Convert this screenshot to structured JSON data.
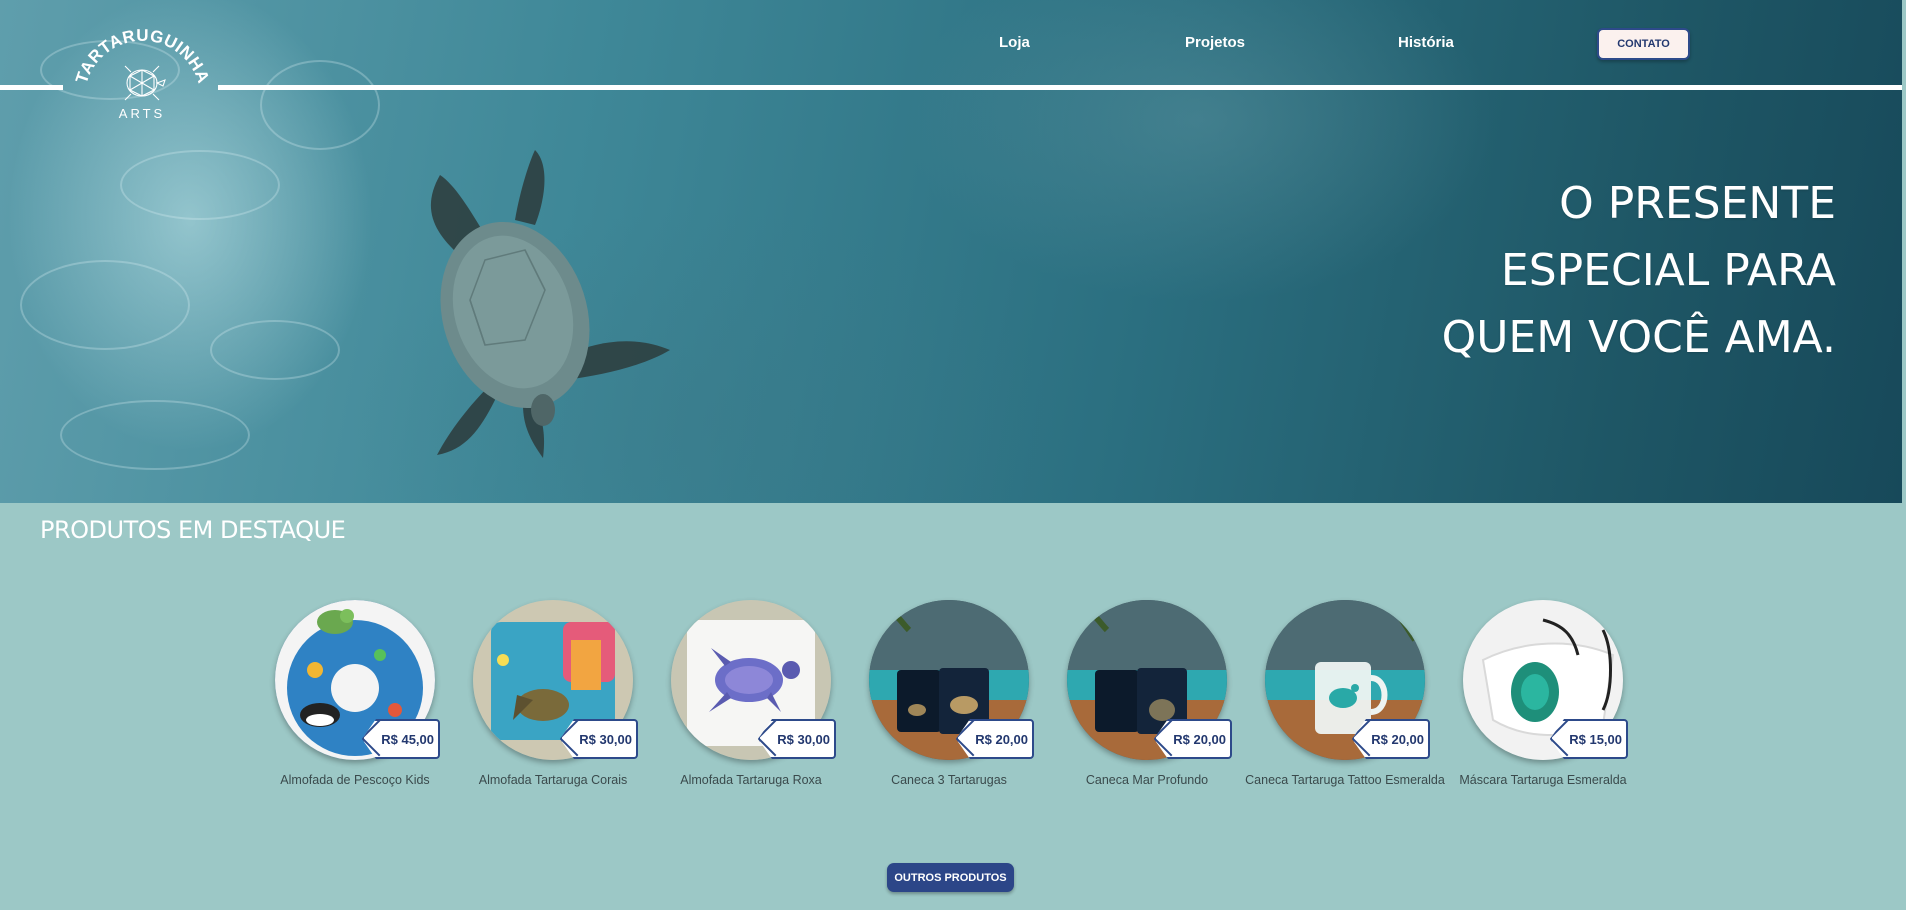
{
  "brand": {
    "logo_text_top": "TARTARUGUINHA",
    "logo_text_bottom": "ARTS"
  },
  "nav": {
    "links": [
      "Loja",
      "Projetos",
      "História"
    ],
    "contact_label": "CONTATO"
  },
  "hero": {
    "headline_lines": [
      "O PRESENTE",
      "ESPECIAL PARA",
      "QUEM VOCÊ AMA."
    ]
  },
  "products_section": {
    "title": "PRODUTOS EM DESTAQUE",
    "items": [
      {
        "name": "Almofada de Pescoço Kids",
        "price": "R$ 45,00"
      },
      {
        "name": "Almofada Tartaruga Corais",
        "price": "R$ 30,00"
      },
      {
        "name": "Almofada Tartaruga Roxa",
        "price": "R$ 30,00"
      },
      {
        "name": "Caneca 3 Tartarugas",
        "price": "R$ 20,00"
      },
      {
        "name": "Caneca Mar Profundo",
        "price": "R$ 20,00"
      },
      {
        "name": "Caneca Tartaruga Tattoo Esmeralda",
        "price": "R$ 20,00"
      },
      {
        "name": "Máscara Tartaruga Esmeralda",
        "price": "R$ 15,00"
      }
    ],
    "more_button_label": "OUTROS PRODUTOS"
  },
  "colors": {
    "accent_navy": "#2c4688",
    "section_background": "#9cc8c6",
    "hero_water": "#2b6f80"
  }
}
